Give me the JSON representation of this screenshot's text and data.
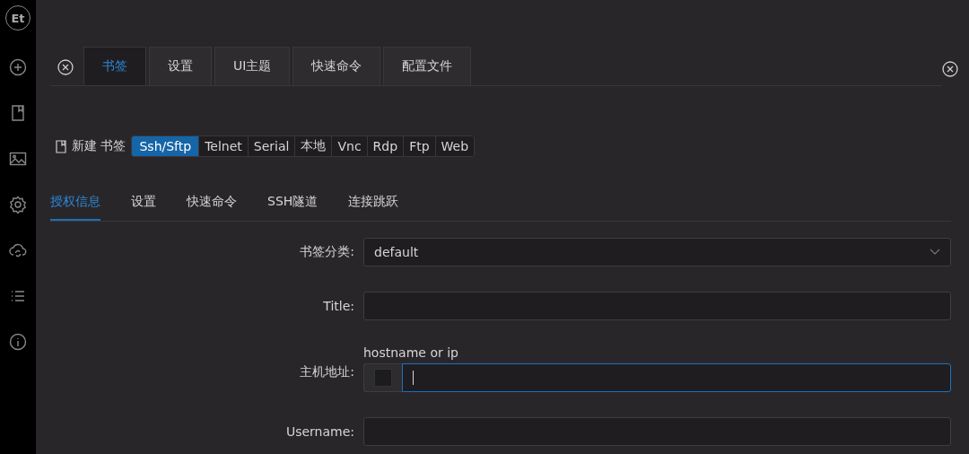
{
  "sidebar": {
    "logo": "Et",
    "items": [
      {
        "kind": "add"
      },
      {
        "kind": "bookmark"
      },
      {
        "kind": "image"
      },
      {
        "kind": "settings"
      },
      {
        "kind": "cloud"
      },
      {
        "kind": "list"
      },
      {
        "kind": "info"
      }
    ]
  },
  "tabs": [
    {
      "label": "书签",
      "selected": true
    },
    {
      "label": "设置",
      "selected": false
    },
    {
      "label": "UI主题",
      "selected": false
    },
    {
      "label": "快速命令",
      "selected": false
    },
    {
      "label": "配置文件",
      "selected": false
    }
  ],
  "new_bookmark": {
    "label": "新建 书签"
  },
  "types": [
    {
      "label": "Ssh/Sftp",
      "selected": true
    },
    {
      "label": "Telnet",
      "selected": false
    },
    {
      "label": "Serial",
      "selected": false
    },
    {
      "label": "本地",
      "selected": false
    },
    {
      "label": "Vnc",
      "selected": false
    },
    {
      "label": "Rdp",
      "selected": false
    },
    {
      "label": "Ftp",
      "selected": false
    },
    {
      "label": "Web",
      "selected": false
    }
  ],
  "subtabs": [
    {
      "label": "授权信息",
      "selected": true
    },
    {
      "label": "设置",
      "selected": false
    },
    {
      "label": "快速命令",
      "selected": false
    },
    {
      "label": "SSH隧道",
      "selected": false
    },
    {
      "label": "连接跳跃",
      "selected": false
    }
  ],
  "form": [
    {
      "kind": "select",
      "label": "书签分类:",
      "value": "default"
    },
    {
      "kind": "text",
      "label": "Title:"
    },
    {
      "kind": "host",
      "label": "主机地址:",
      "hint": "hostname or ip",
      "focused": true
    },
    {
      "kind": "text",
      "label": "Username:"
    }
  ]
}
